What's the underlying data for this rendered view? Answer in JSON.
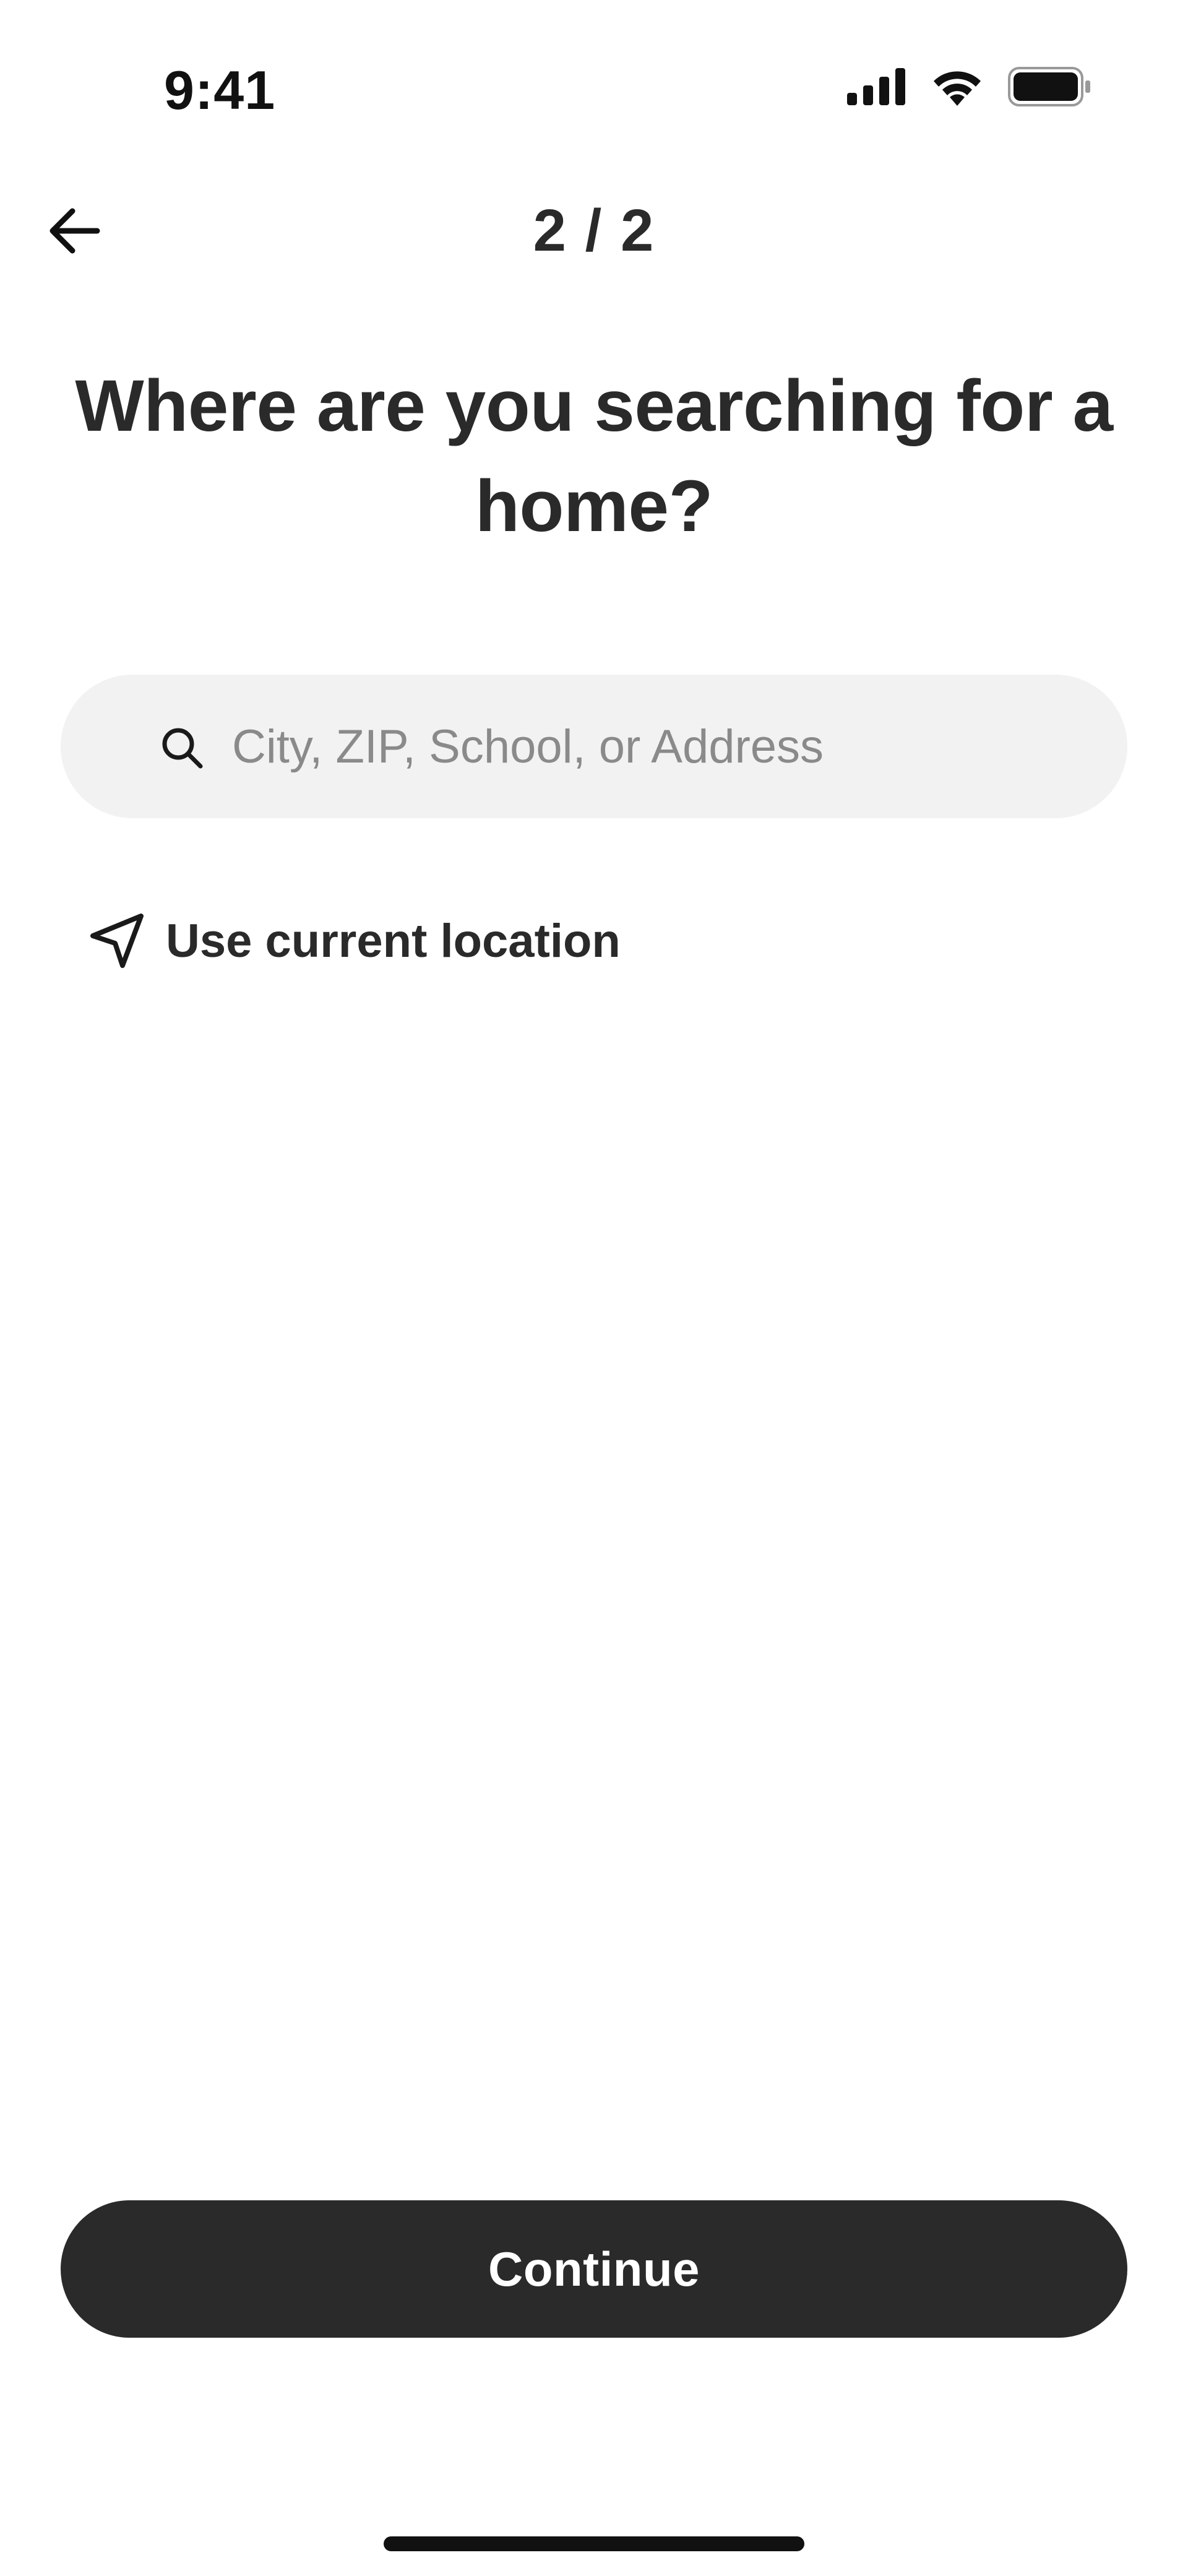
{
  "status_bar": {
    "time": "9:41",
    "icons": [
      "cellular-signal-icon",
      "wifi-icon",
      "battery-icon"
    ]
  },
  "header": {
    "back_icon": "arrow-left-icon",
    "step": "2 / 2"
  },
  "title": "Where are you searching for a home?",
  "search": {
    "icon": "search-icon",
    "placeholder": "City, ZIP, School, or Address",
    "value": ""
  },
  "location": {
    "icon": "navigation-arrow-icon",
    "label": "Use current location"
  },
  "continue_button": {
    "label": "Continue"
  },
  "colors": {
    "primary_dark": "#2a2a2a",
    "search_bg": "#f2f2f2",
    "placeholder": "#8a8a8a",
    "background": "#ffffff"
  }
}
